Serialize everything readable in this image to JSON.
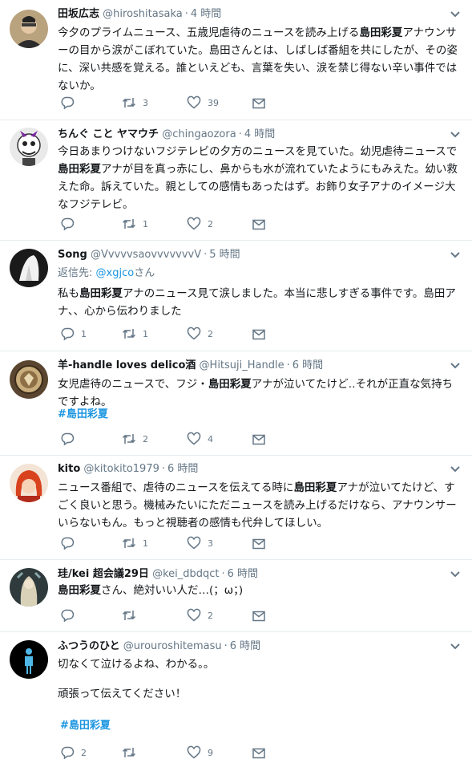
{
  "tweets": [
    {
      "name": "田坂広志",
      "handle": "@hiroshitasaka",
      "time": "4 時間",
      "text": [
        "今夕のプライムニュース、五歳児虐待のニュースを読み上げる",
        "島田彩夏",
        "アナウンサーの目から涙がこぼれていた。島田さんとは、しばしば番組を共にしたが、その姿に、深い共感を覚える。誰といえども、言葉を失い、涙を禁じ得ない辛い事件ではないか。"
      ],
      "reply": "",
      "retweets": "3",
      "likes": "39"
    },
    {
      "name": "ちんぐ こと ヤマウチ",
      "handle": "@chingaozora",
      "time": "4 時間",
      "text": [
        "今日あまりつけないフジテレビの夕方のニュースを見ていた。幼児虐待ニュースで",
        "島田彩夏",
        "アナが目を真っ赤にし、鼻からも水が流れていたようにもみえた。幼い救えた命。訴えていた。親としての感情もあったはず。お飾り女子アナのイメージ大なフジテレビ。"
      ],
      "reply": "",
      "retweets": "1",
      "likes": "2"
    },
    {
      "name": "Song",
      "handle": "@VvvvvsaovvvvvvvV",
      "time": "5 時間",
      "reply_to_label": "返信先:",
      "reply_to_handle": "@xgjco",
      "reply_to_suffix": "さん",
      "text": [
        "私も",
        "島田彩夏",
        "アナのニュース見て涙しました。本当に悲しすぎる事件です。島田アナ、、心から伝わりました"
      ],
      "reply": "1",
      "retweets": "1",
      "likes": "2"
    },
    {
      "name": "羊-handle loves delico酒",
      "handle": "@Hitsuji_Handle",
      "time": "6 時間",
      "text": [
        "女児虐待のニュースで、フジ・",
        "島田彩夏",
        "アナが泣いてたけど‥それが正直な気持ちですよね。"
      ],
      "hashtag": "#島田彩夏",
      "reply": "",
      "retweets": "2",
      "likes": "4"
    },
    {
      "name": "kito",
      "handle": "@kitokito1979",
      "time": "6 時間",
      "text": [
        "ニュース番組で、虐待のニュースを伝えてる時に",
        "島田彩夏",
        "アナが泣いてたけど、すごく良いと思う。機械みたいにただニュースを読み上げるだけなら、アナウンサーいらないもん。もっと視聴者の感情も代弁してほしい。"
      ],
      "reply": "",
      "retweets": "1",
      "likes": "3"
    },
    {
      "name": "珪/kei 超会議29日",
      "handle": "@kei_dbdqct",
      "time": "6 時間",
      "text": [
        "",
        "島田彩夏",
        "さん、絶対いい人だ…(；ω；)"
      ],
      "reply": "",
      "retweets": "",
      "likes": "2"
    },
    {
      "name": "ふつうのひと",
      "handle": "@urouroshitemasu",
      "time": "6 時間",
      "text": [
        "切なくて泣けるよね、わかる。。",
        "",
        ""
      ],
      "text2": "頑張って伝えてください！",
      "hashtag": "#島田彩夏",
      "reply": "2",
      "retweets": "",
      "likes": "9"
    }
  ]
}
